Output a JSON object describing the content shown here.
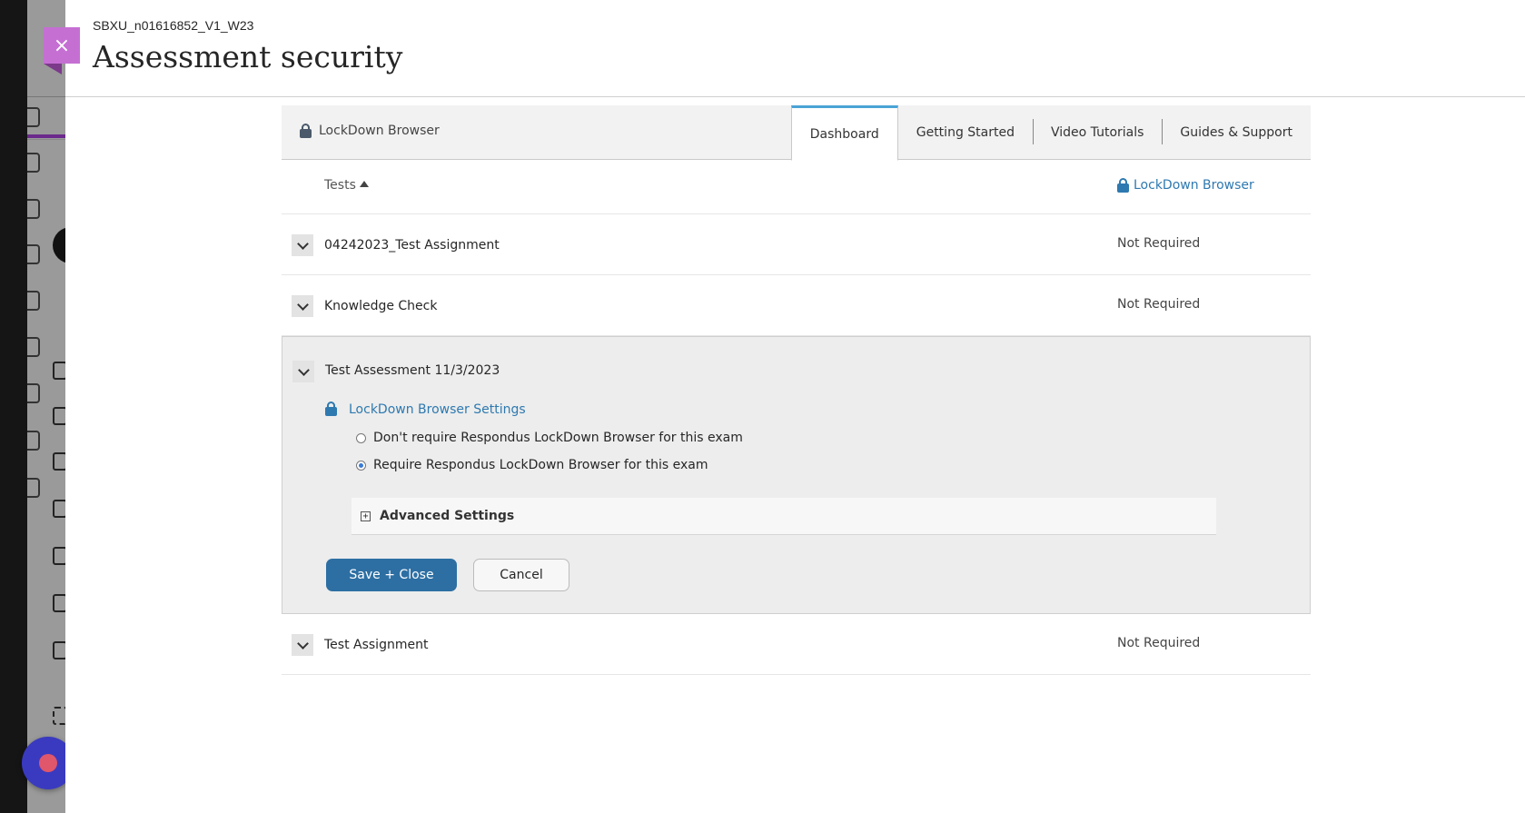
{
  "modal": {
    "course_id": "SBXU_n01616852_V1_W23",
    "title": "Assessment security",
    "close_icon": "×"
  },
  "ldb": {
    "brand": "LockDown Browser",
    "tabs": [
      {
        "label": "Dashboard",
        "active": true
      },
      {
        "label": "Getting Started",
        "active": false
      },
      {
        "label": "Video Tutorials",
        "active": false
      },
      {
        "label": "Guides & Support",
        "active": false
      }
    ],
    "columns": {
      "tests": "Tests",
      "ldb": "LockDown Browser"
    },
    "rows": [
      {
        "name": "04242023_Test Assignment",
        "status": "Not Required"
      },
      {
        "name": "Knowledge Check",
        "status": "Not Required"
      },
      {
        "name": "Test Assessment 11/3/2023",
        "expanded": true
      },
      {
        "name": "Test Assignment",
        "status": "Not Required"
      }
    ],
    "expanded": {
      "settings_link": "LockDown Browser Settings",
      "options": [
        {
          "label": "Don't require Respondus LockDown Browser for this exam",
          "checked": false
        },
        {
          "label": "Require Respondus LockDown Browser for this exam",
          "checked": true
        }
      ],
      "advanced_settings": "Advanced Settings",
      "advanced_icon": "+",
      "save_label": "Save + Close",
      "cancel_label": "Cancel"
    }
  },
  "colors": {
    "accent_link": "#2e79b0",
    "save_button": "#2d6fa3",
    "close_button": "#c56fd3",
    "active_tab_indicator": "#4aa3d6"
  }
}
